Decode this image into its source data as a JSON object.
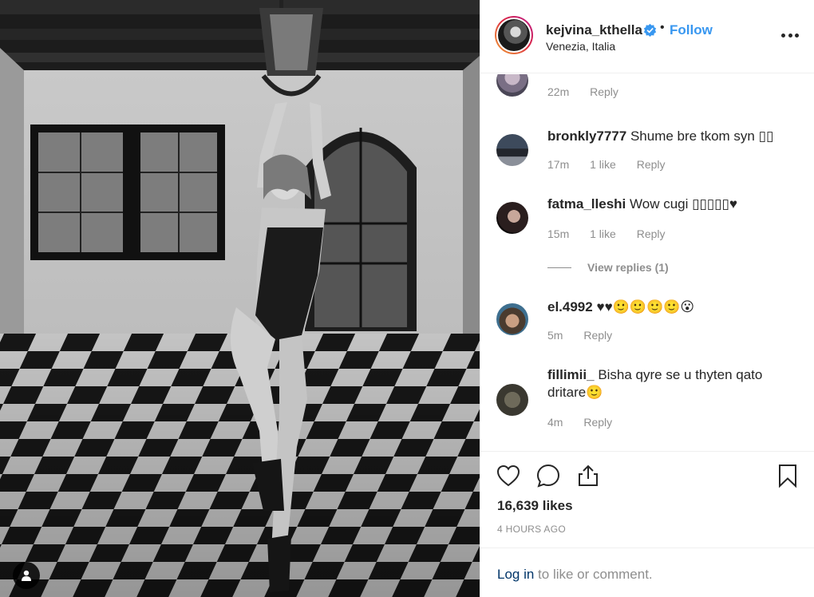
{
  "post": {
    "username": "kejvina_kthella",
    "separator": "•",
    "follow_label": "Follow",
    "location": "Venezia, Italia",
    "verified_icon": "verified-badge-icon"
  },
  "comments": [
    {
      "username": "",
      "text": "",
      "time": "22m",
      "likes": "",
      "reply": "Reply"
    },
    {
      "username": "bronkly7777",
      "text": "Shume bre tkom syn ▯▯",
      "time": "17m",
      "likes": "1 like",
      "reply": "Reply"
    },
    {
      "username": "fatma_lleshi",
      "text": "Wow cugi ▯▯▯▯▯♥",
      "time": "15m",
      "likes": "1 like",
      "reply": "Reply",
      "view_replies": "View replies (1)"
    },
    {
      "username": "el.4992",
      "text": "♥♥🙂🙂🙂🙂😮",
      "time": "5m",
      "likes": "",
      "reply": "Reply"
    },
    {
      "username": "fillimii_",
      "text": "Bisha qyre se u thyten qato dritare🙂",
      "time": "4m",
      "likes": "",
      "reply": "Reply"
    }
  ],
  "actions": {
    "icons": [
      "heart-icon",
      "comment-icon",
      "share-icon",
      "bookmark-icon"
    ],
    "likes": "16,639 likes",
    "time_ago": "4 HOURS AGO"
  },
  "login": {
    "link": "Log in",
    "rest": " to like or comment."
  },
  "colors": {
    "accent": "#3897f0",
    "text": "#262626",
    "muted": "#8e8e8e",
    "border": "#efefef",
    "login_link": "#003569"
  }
}
